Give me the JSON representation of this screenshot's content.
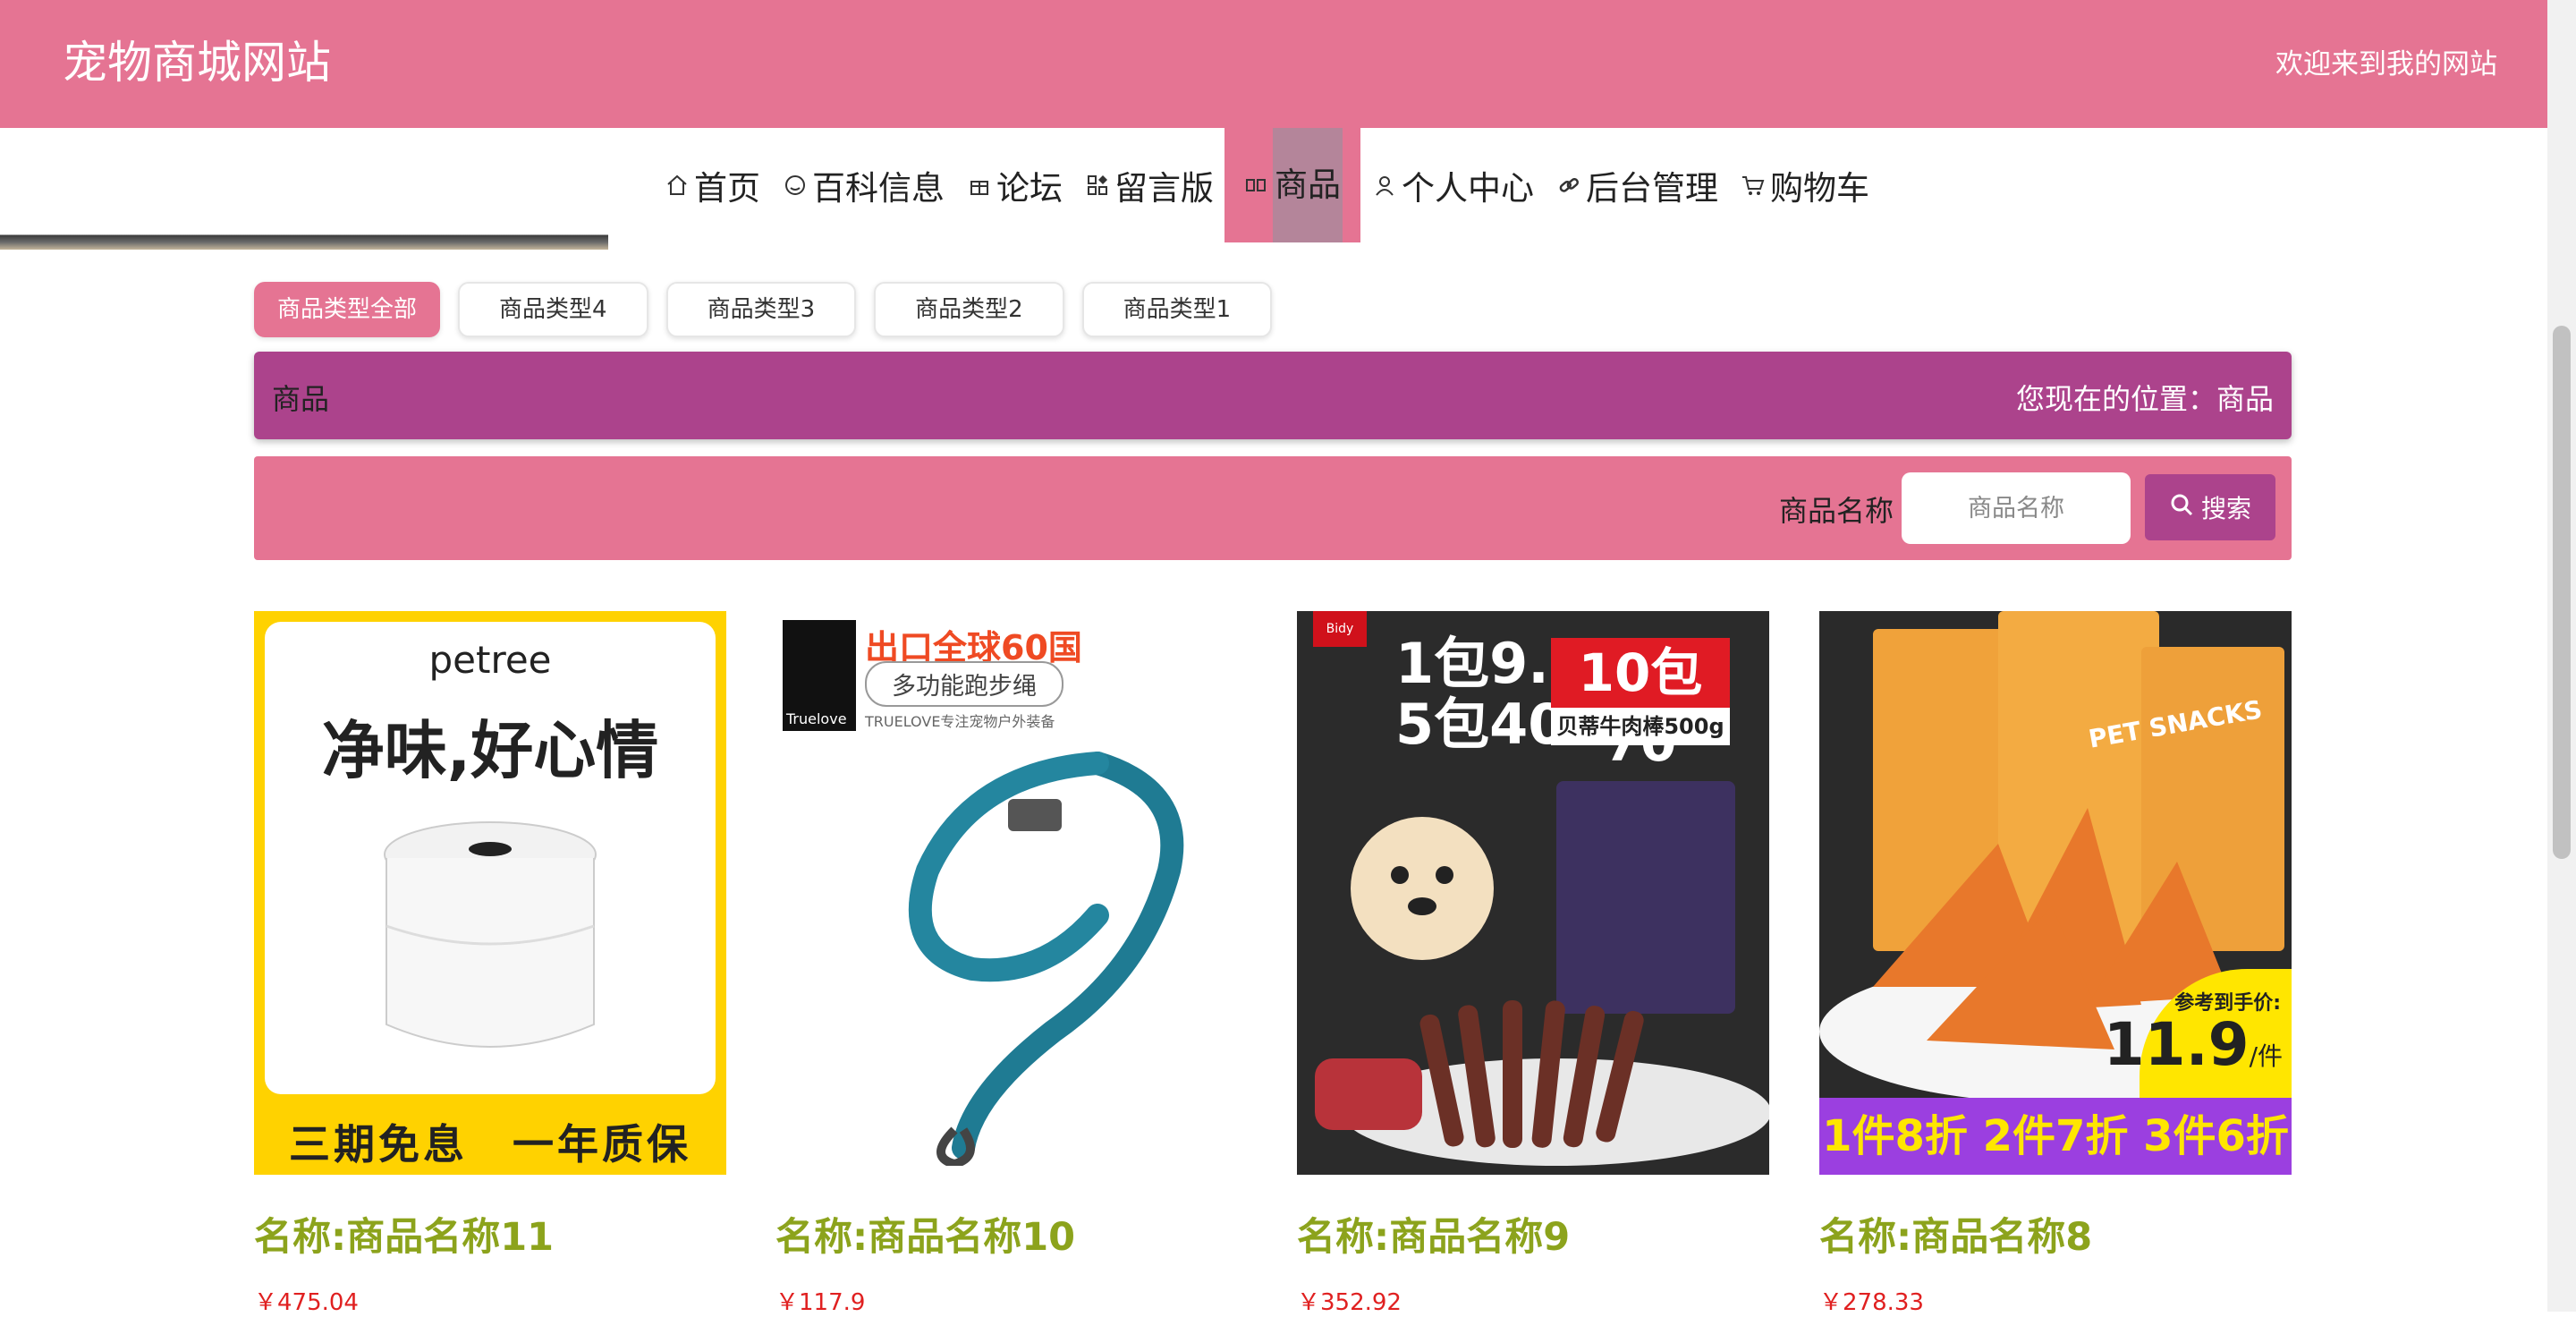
{
  "header": {
    "site_title": "宠物商城网站",
    "welcome": "欢迎来到我的网站",
    "bg_color": "#e57493"
  },
  "nav": {
    "items": [
      {
        "label": "首页",
        "icon": "home-icon"
      },
      {
        "label": "百科信息",
        "icon": "chat-bubble-icon"
      },
      {
        "label": "论坛",
        "icon": "gift-icon"
      },
      {
        "label": "留言版",
        "icon": "grid-icon"
      },
      {
        "label": "商品",
        "icon": "goods-icon",
        "active": true
      },
      {
        "label": "个人中心",
        "icon": "user-icon"
      },
      {
        "label": "后台管理",
        "icon": "link-icon"
      },
      {
        "label": "购物车",
        "icon": "cart-icon"
      }
    ]
  },
  "filters": {
    "types": [
      "商品类型全部",
      "商品类型4",
      "商品类型3",
      "商品类型2",
      "商品类型1"
    ],
    "active": "商品类型全部"
  },
  "breadcrumb": {
    "title": "商品",
    "position": "您现在的位置：商品",
    "bg_color": "#ac438c"
  },
  "search": {
    "label": "商品名称",
    "placeholder": "商品名称",
    "value": "",
    "button_label": "搜索"
  },
  "products": [
    {
      "name": "名称:商品名称11",
      "price": "￥475.04",
      "image": {
        "brand": "petree",
        "slogan": "净味,好心情",
        "bottom": "三期免息　一年质保"
      }
    },
    {
      "name": "名称:商品名称10",
      "price": "￥117.9",
      "image": {
        "headline": "出口全球60国",
        "sub": "多功能跑步绳",
        "note": "TRUELOVE专注宠物户外装备",
        "logo": "Truelove"
      }
    },
    {
      "name": "名称:商品名称9",
      "price": "￥352.92",
      "image": {
        "line1": "1包9.9",
        "line2": "5包40",
        "deal": "10包70",
        "sub": "贝蒂牛肉棒500g",
        "tag": "Bidy"
      }
    },
    {
      "name": "名称:商品名称8",
      "price": "￥278.33",
      "image": {
        "ref": "参考到手价:",
        "price": "11.9",
        "unit": "/件",
        "promo": "1件8折 2件7折 3件6折",
        "label": "PET SNACKS"
      }
    }
  ]
}
